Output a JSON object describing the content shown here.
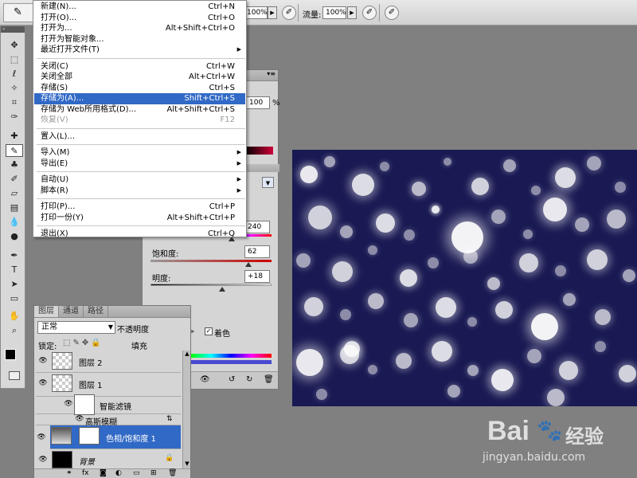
{
  "options_bar": {
    "opacity_value": "100%",
    "flow_label": "流量:",
    "flow_value": "100%"
  },
  "file_menu": {
    "items": [
      {
        "label": "新建(N)...",
        "shortcut": "Ctrl+N"
      },
      {
        "label": "打开(O)...",
        "shortcut": "Ctrl+O"
      },
      {
        "label": "打开为...",
        "shortcut": "Alt+Shift+Ctrl+O"
      },
      {
        "label": "打开为智能对象...",
        "shortcut": ""
      },
      {
        "label": "最近打开文件(T)",
        "shortcut": "",
        "submenu": true
      },
      {
        "label": "关闭(C)",
        "shortcut": "Ctrl+W"
      },
      {
        "label": "关闭全部",
        "shortcut": "Alt+Ctrl+W"
      },
      {
        "label": "存储(S)",
        "shortcut": "Ctrl+S"
      },
      {
        "label": "存储为(A)...",
        "shortcut": "Shift+Ctrl+S",
        "highlighted": true
      },
      {
        "label": "存储为 Web所用格式(D)...",
        "shortcut": "Alt+Shift+Ctrl+S"
      },
      {
        "label": "恢复(V)",
        "shortcut": "F12",
        "disabled": true
      },
      {
        "label": "置入(L)...",
        "shortcut": ""
      },
      {
        "label": "导入(M)",
        "shortcut": "",
        "submenu": true
      },
      {
        "label": "导出(E)",
        "shortcut": "",
        "submenu": true
      },
      {
        "label": "自动(U)",
        "shortcut": "",
        "submenu": true
      },
      {
        "label": "脚本(R)",
        "shortcut": "",
        "submenu": true
      },
      {
        "label": "打印(P)...",
        "shortcut": "Ctrl+P"
      },
      {
        "label": "打印一份(Y)",
        "shortcut": "Alt+Shift+Ctrl+P"
      },
      {
        "label": "退出(X)",
        "shortcut": "Ctrl+Q"
      }
    ]
  },
  "hue_sat_panel": {
    "hue_value": "240",
    "saturation_label": "饱和度:",
    "saturation_value": "62",
    "lightness_label": "明度:",
    "lightness_value": "+18",
    "colorize_label": "着色",
    "colorize_checked": true,
    "top_value": "100",
    "top_unit": "%",
    "hue_level": 0.67,
    "saturation_level": 0.81,
    "lightness_level": 0.59
  },
  "layers_panel": {
    "tabs": [
      "图层",
      "通道",
      "路径"
    ],
    "blend_mode": "正常",
    "opacity_label": "不透明度",
    "lock_label": "锁定:",
    "fill_label": "填充",
    "layers": [
      {
        "name": "图层 2"
      },
      {
        "name": "图层 1"
      },
      {
        "name": "智能滤镜"
      },
      {
        "name": "高斯模糊"
      },
      {
        "name": "色相/饱和度 1",
        "selected": true
      },
      {
        "name": "背景"
      }
    ]
  },
  "watermark": {
    "brand_text": "Bai",
    "brand_text2": "经验",
    "url": "jingyan.baidu.com"
  },
  "colors": {
    "menu_highlight": "#3169c6",
    "canvas_bg": "#191953",
    "selected_layer": "#3169c6"
  }
}
